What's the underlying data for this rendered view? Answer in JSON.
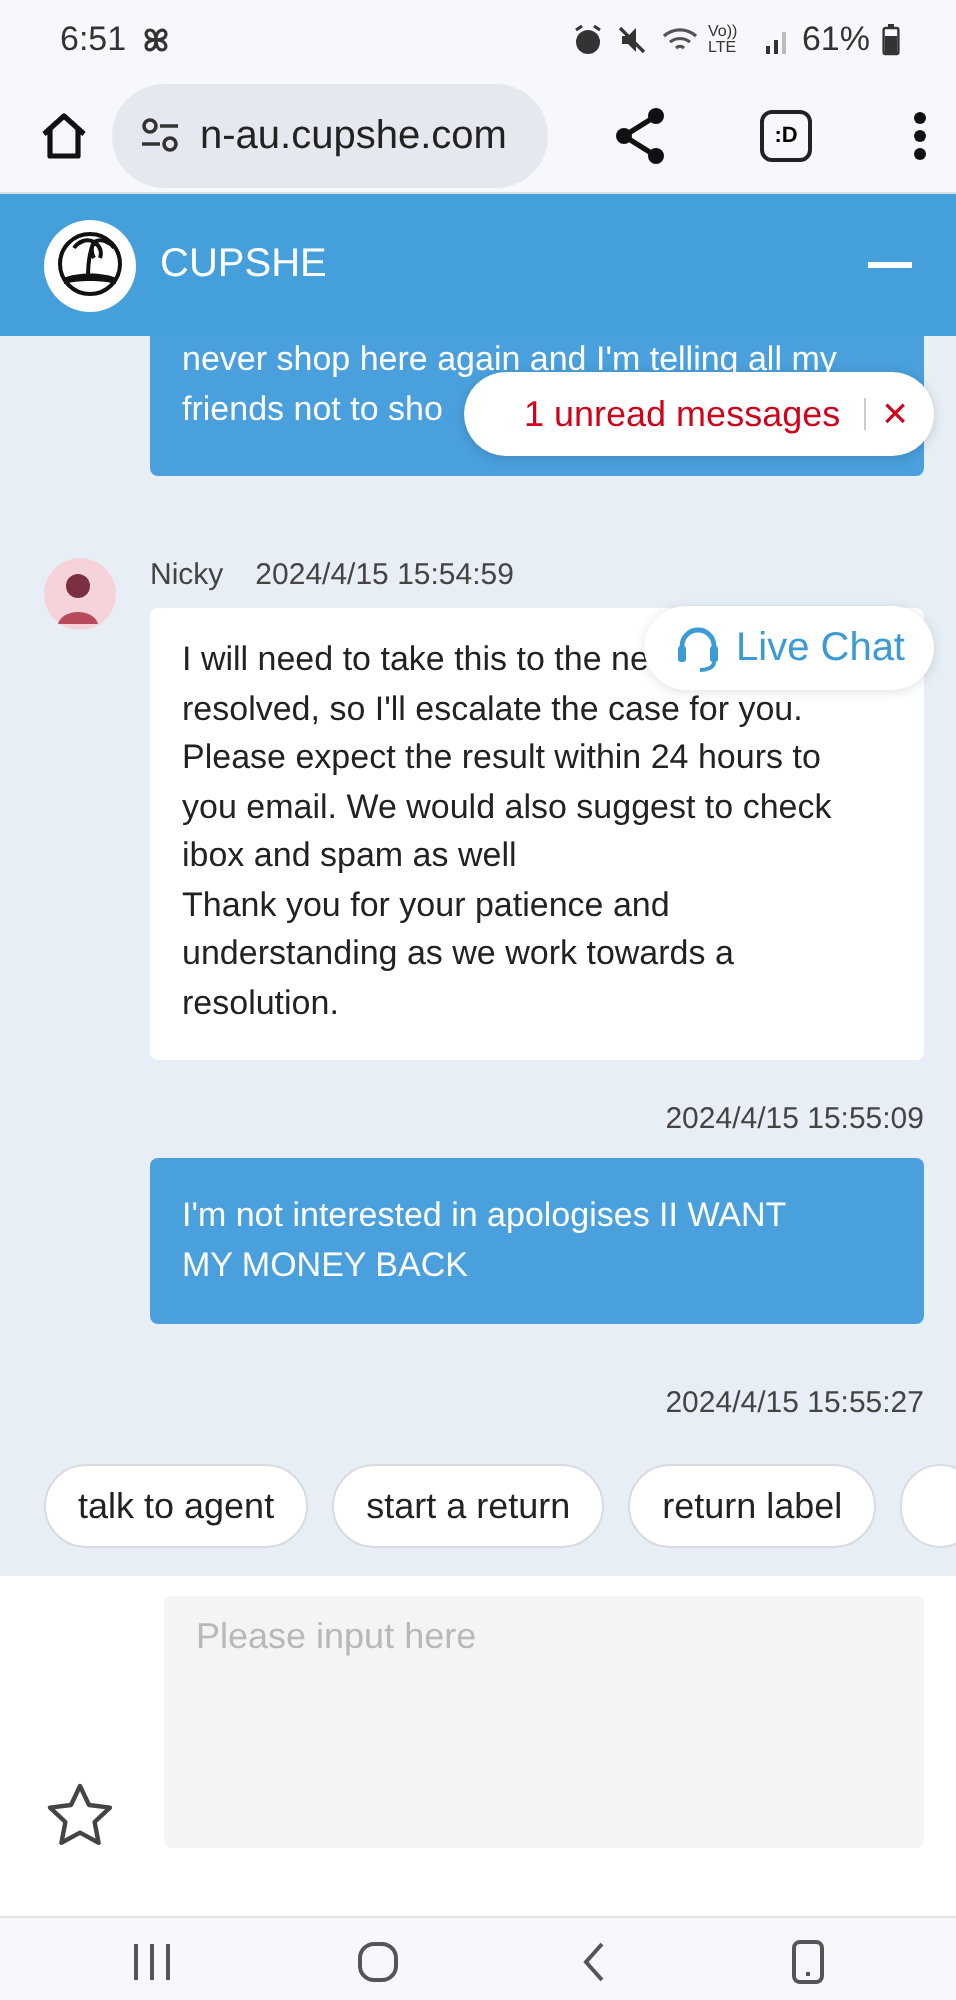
{
  "status_bar": {
    "time": "6:51",
    "network": "Vo)) LTE",
    "battery": "61%"
  },
  "browser": {
    "url": "n-au.cupshe.com",
    "tab_switcher": ":D"
  },
  "header": {
    "title": "CUPSHE"
  },
  "messages": [
    {
      "kind": "outgoing",
      "text": "never shop here again and I'm telling all my\nfriends not to sho"
    },
    {
      "kind": "incoming",
      "sender": "Nicky",
      "time": "2024/4/15 15:54:59",
      "text": "I will need to take this to the ne\nresolved, so I'll escalate the case for you.\nPlease expect the result within 24 hours to\nyou email. We would also suggest to check\nibox and spam as well\nThank you for your patience and\nunderstanding as we work towards a\nresolution."
    },
    {
      "kind": "time",
      "text": "2024/4/15 15:55:09"
    },
    {
      "kind": "outgoing",
      "text": "I'm not interested in apologises II WANT\nMY MONEY BACK"
    },
    {
      "kind": "time",
      "text": "2024/4/15 15:55:27"
    }
  ],
  "unread_toast": {
    "text": "1 unread messages",
    "close": "×"
  },
  "live_chat": {
    "label": "Live Chat"
  },
  "quick_replies": [
    "talk to agent",
    "start a return",
    "return label"
  ],
  "composer": {
    "placeholder": "Please input here"
  }
}
